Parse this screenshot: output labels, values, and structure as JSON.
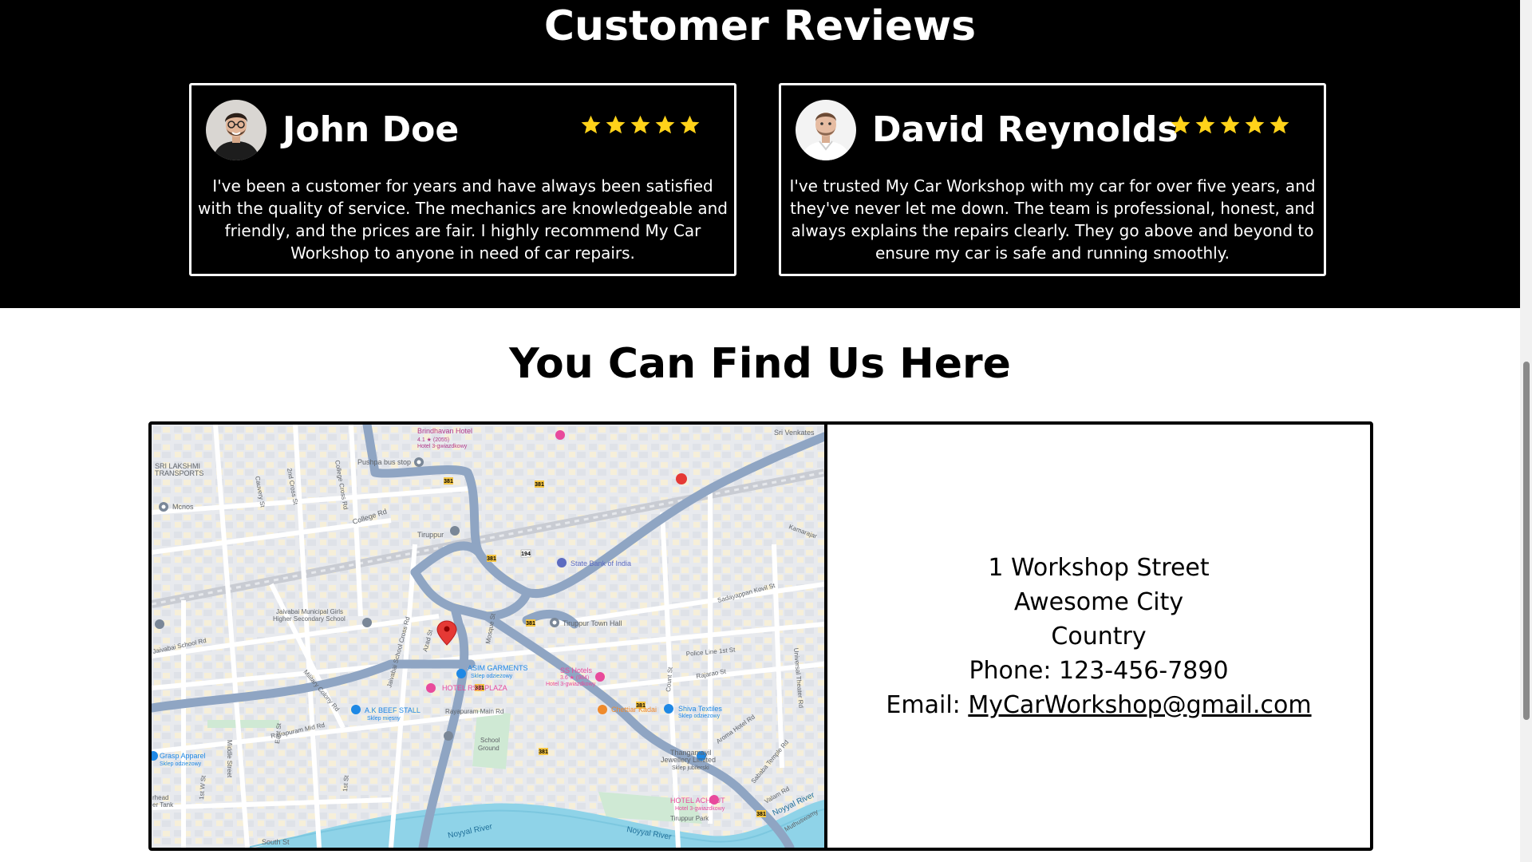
{
  "reviews": {
    "title": "Customer Reviews",
    "items": [
      {
        "name": "John Doe",
        "rating": 5,
        "text": "I've been a customer for years and have always been satisfied with the quality of service. The mechanics are knowledgeable and friendly, and the prices are fair. I highly recommend My Car Workshop to anyone in need of car repairs."
      },
      {
        "name": "David Reynolds",
        "rating": 5,
        "text": "I've trusted My Car Workshop with my car for over five years, and they've never let me down. The team is professional, honest, and always explains the repairs clearly. They go above and beyond to ensure my car is safe and running smoothly."
      }
    ]
  },
  "location": {
    "title": "You Can Find Us Here",
    "address_line1": "1 Workshop Street",
    "address_line2": "Awesome City",
    "address_line3": "Country",
    "phone_label": "Phone: ",
    "phone": "123-456-7890",
    "email_label": "Email: ",
    "email": "MyCarWorkshop@gmail.com"
  },
  "map": {
    "labels": {
      "sri_lakshmi": "SRI LAKSHMI",
      "transports": "TRANSPORTS",
      "mcnos": "Mcnos",
      "pushpa": "Pushpa bus stop",
      "college_rd": "College Rd",
      "college_cross": "College Cross Rd",
      "cauvery": "Cauvery St",
      "second_cross": "2nd Cross St",
      "brindhavan": "Brindhavan Hotel",
      "brindhavan_rating": "4.1 ★ (2055)",
      "brindhavan_sub": "Hotel 3-gwiazdkowy",
      "sri_venkates": "Sri Venkates",
      "tiruppur": "Tiruppur",
      "state_bank": "State Bank of India",
      "kamarajar": "Kamarajar",
      "sadayappan": "Sadayappan Kovil St",
      "town_hall": "Tiruppur Town Hall",
      "jaivabai1": "Jaivabai Municipal Girls",
      "jaivabai2": "Higher Secondary School",
      "jaivabai_rd": "Jaivabai School Rd",
      "jaivabai_cross": "Jaivabai School Cross Rd",
      "azad": "Azad St",
      "mosque": "Mosque St",
      "asim": "ASIM GARMENTS",
      "asim_sub": "Sklep odzieżowy",
      "ss_hotels": "SS Hotels",
      "ss_rating": "3.6 ★ (984)",
      "ss_sub": "Hotel 3-gwiazdkowy",
      "police_line": "Police Line 1st St",
      "rajarao": "Rajarao St",
      "universal": "Universal Theater Rd",
      "hotel_rsb": "HOTEL RSB PLAZA",
      "military": "Military Colony Rd",
      "rayapuram_main": "Rayapuram Main Rd",
      "rayapuram_mid": "Rayapuram Mid Rd",
      "ak_beef": "A.K BEEF STALL",
      "ak_sub": "Sklep mięsny",
      "chettiar": "Chettiar Kadai",
      "shiva": "Shiva Textiles",
      "shiva_sub": "Sklep odzieżowy",
      "aroma": "Aroma Hotel Rd",
      "school_ground1": "School",
      "school_ground2": "Ground",
      "grasp": "Grasp Apparel",
      "grasp_sub": "Sklep odzieżowy",
      "middle_street": "Middle Street",
      "thangamayil1": "Thangamayil",
      "thangamayil2": "Jewellery Limited",
      "thangamayil_sub": "Sklep jubilerski",
      "sabapathy": "Sababa Temple Rd",
      "valam": "Valam Rd",
      "noyyal1": "Noyyal River",
      "noyyal2": "Noyyal River",
      "noyyal3": "Noyyal River",
      "muthuswamy": "Muthuswamy",
      "hotel_achyut": "HOTEL ACHYUT",
      "achyut_sub": "Hotel 3-gwiazdkowy",
      "tiruppur_park": "Tiruppur Park",
      "south_st": "South St",
      "first_w_st": "1st W St",
      "east_st": "East St",
      "north_st": "1st St",
      "head_tank1": "rhead",
      "head_tank2": "er Tank",
      "count_st": "Count St",
      "road_381": "381",
      "road_194": "194"
    }
  }
}
